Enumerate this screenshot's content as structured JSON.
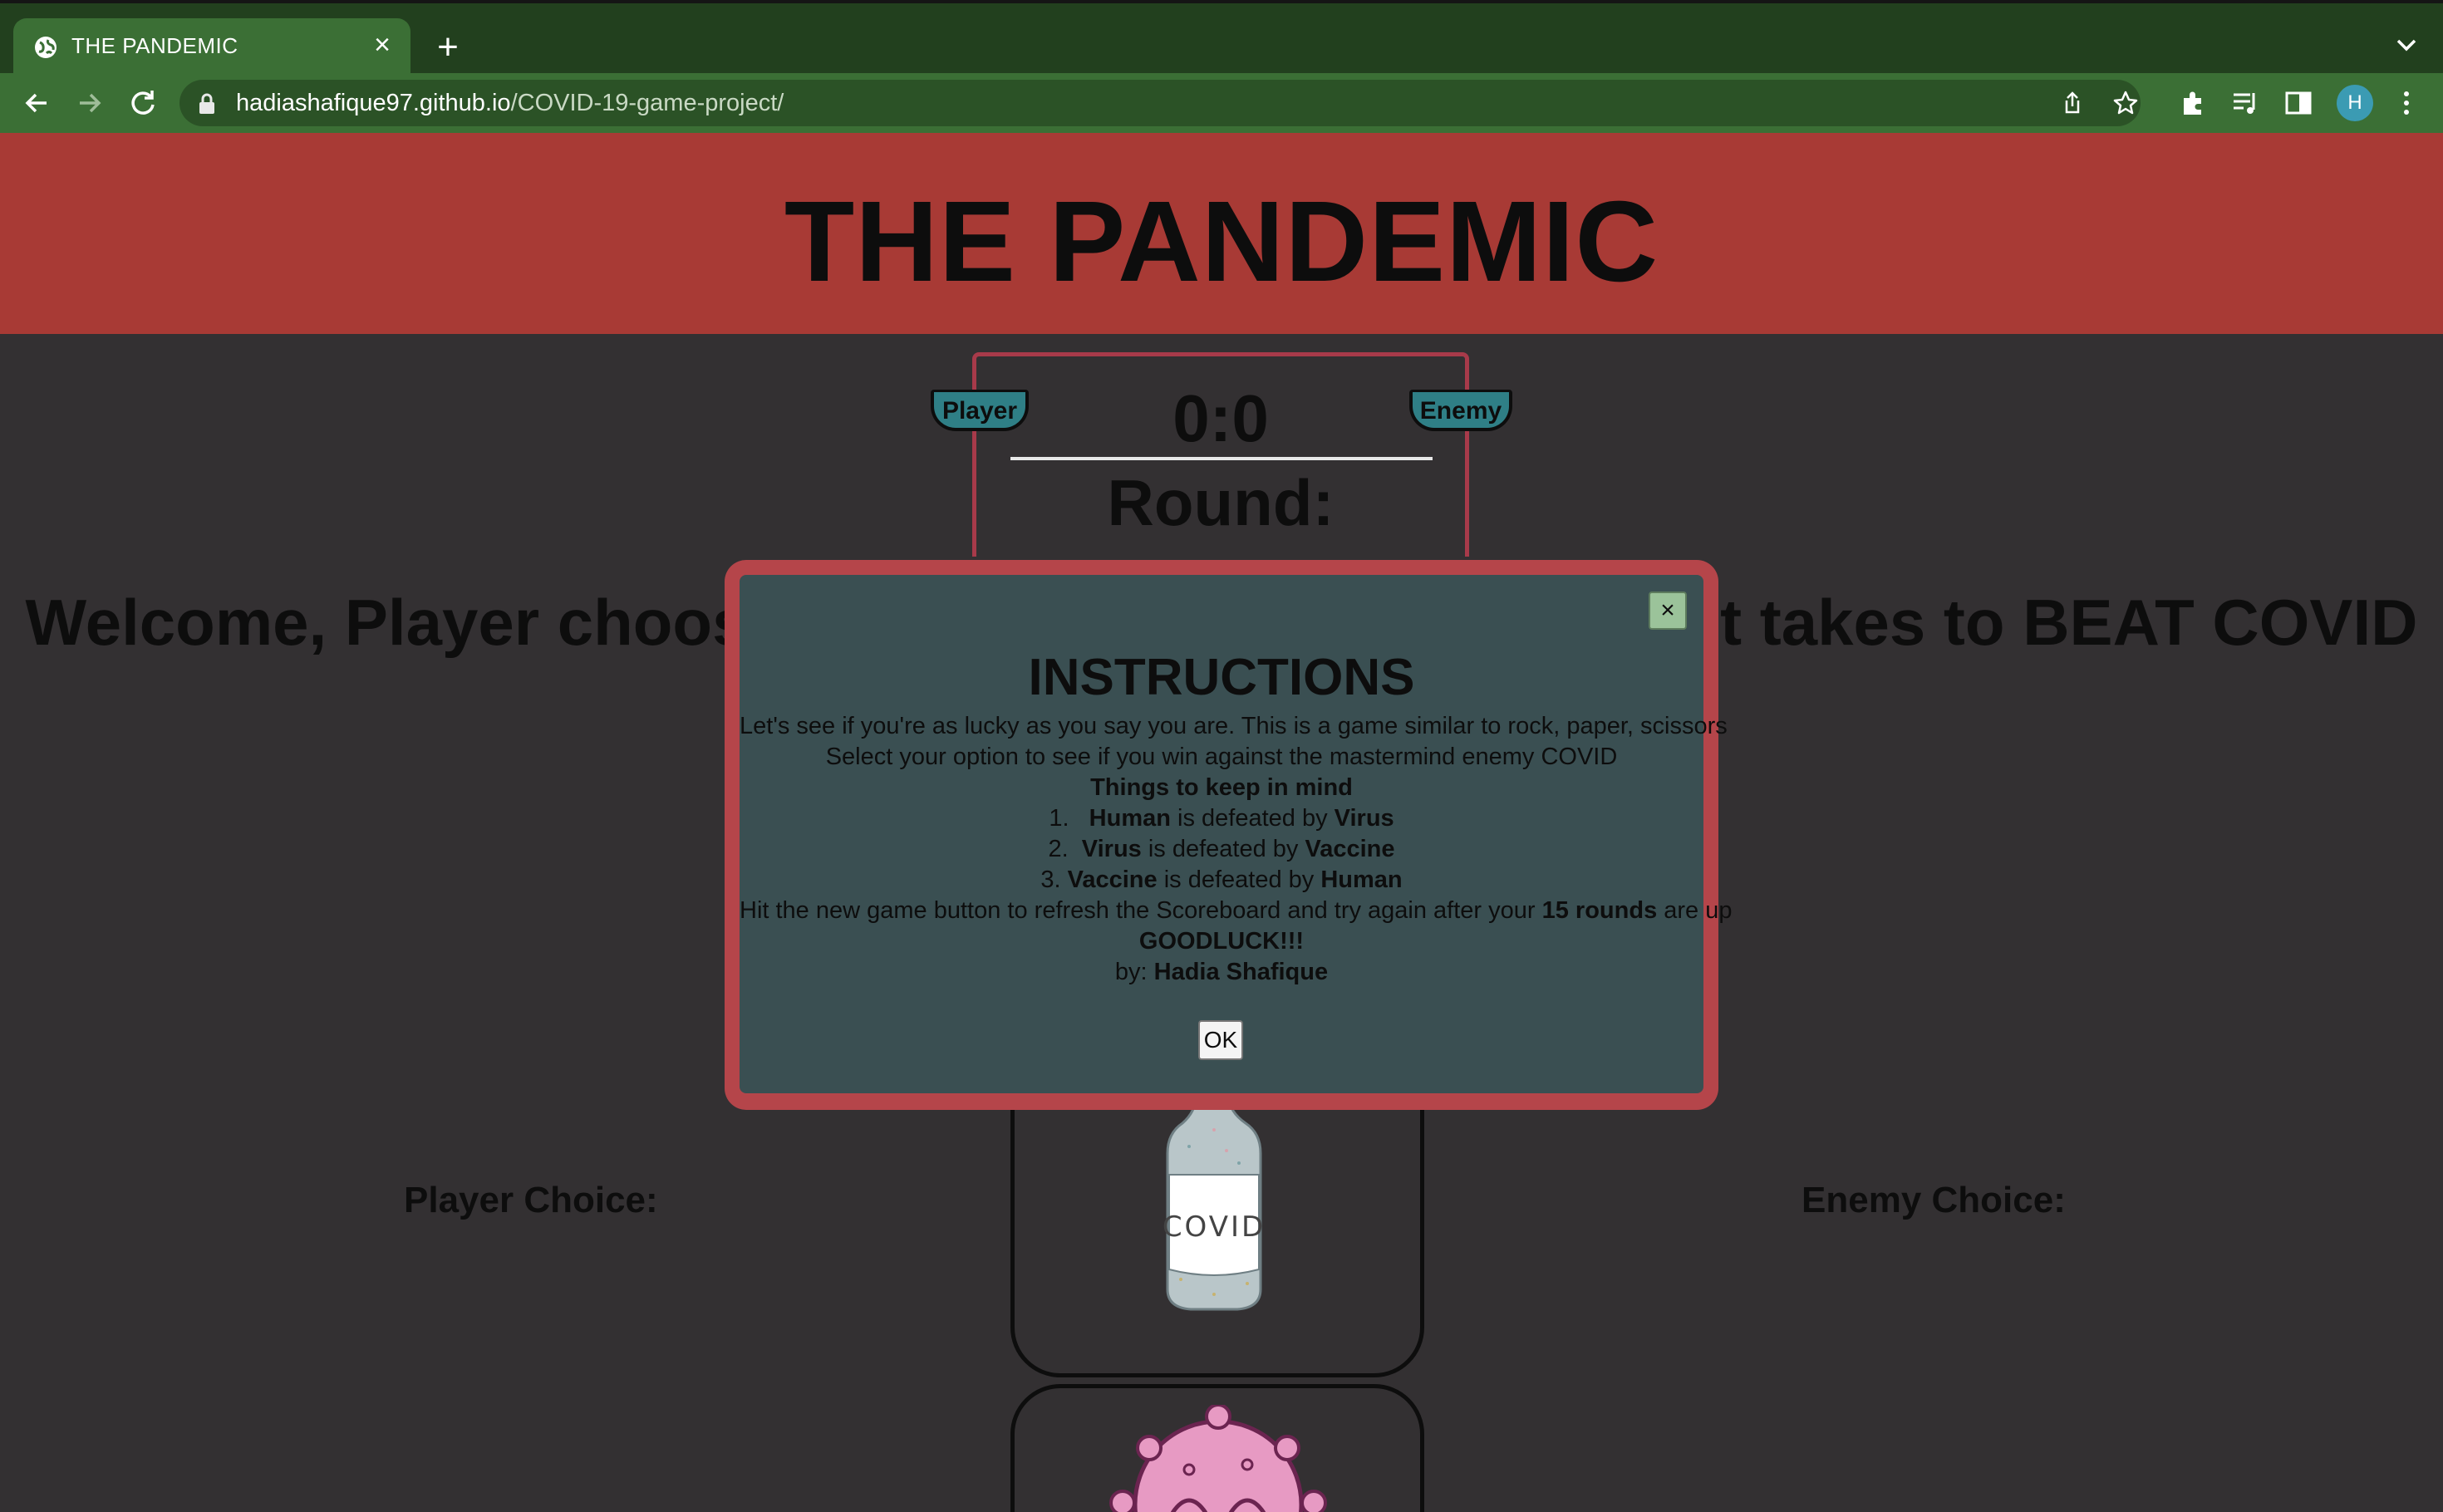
{
  "browser": {
    "tab_title": "THE PANDEMIC",
    "tab_close": "×",
    "new_tab": "+",
    "url_host": "hadiashafique97.github.io",
    "url_path": "/COVID-19-game-project/",
    "avatar_letter": "H"
  },
  "header": {
    "title": "THE PANDEMIC"
  },
  "scoreboard": {
    "player_label": "Player",
    "enemy_label": "Enemy",
    "score": "0:0",
    "round_label": "Round:"
  },
  "welcome": "Welcome, Player choos",
  "welcome_end": "it takes to BEAT COVID",
  "choices": {
    "player_label": "Player Choice:",
    "enemy_label": "Enemy Choice:",
    "vaccine_text": "COVID"
  },
  "modal": {
    "close": "×",
    "title": "INSTRUCTIONS",
    "line1": "Let's see if you're as lucky as you say you are. This is a game similar to rock, paper, scissors",
    "line2": "Select your option to see if you win against the mastermind enemy COVID",
    "things_heading": "Things to keep in mind",
    "rule1_num": "1.",
    "rule1_a": "Human",
    "rule1_mid": " is defeated by ",
    "rule1_b": "Virus",
    "rule2_num": "2.",
    "rule2_a": "Virus",
    "rule2_mid": " is defeated by ",
    "rule2_b": "Vaccine",
    "rule3_num": "3.",
    "rule3_a": "Vaccine",
    "rule3_mid": " is defeated by ",
    "rule3_b": "Human",
    "newgame_a": "Hit the new game button to refresh the Scoreboard and try again after your ",
    "newgame_b": "15 rounds",
    "newgame_c": " are up",
    "goodluck": "GOODLUCK!!!",
    "by_label": "by: ",
    "author": "Hadia Shafique",
    "ok": "OK"
  },
  "colors": {
    "banner": "#a83a35",
    "page_bg": "#333032",
    "modal_bg": "#3a4f52",
    "modal_border": "#b5454a",
    "badge": "#2f7f86"
  }
}
